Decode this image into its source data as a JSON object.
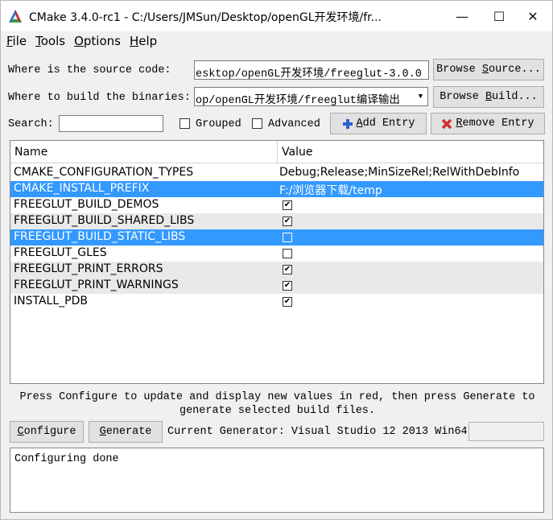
{
  "window": {
    "title": "CMake 3.4.0-rc1 - C:/Users/JMSun/Desktop/openGL开发环境/fr...",
    "minimize": "—",
    "maximize": "☐",
    "close": "✕"
  },
  "menu": {
    "file": {
      "accel": "F",
      "rest": "ile"
    },
    "tools": {
      "accel": "T",
      "rest": "ools"
    },
    "options": {
      "accel": "O",
      "rest": "ptions"
    },
    "help": {
      "accel": "H",
      "rest": "elp"
    }
  },
  "source": {
    "label": "Where is the source code:",
    "value": "esktop/openGL开发环境/freeglut-3.0.0",
    "button_pre": "Browse ",
    "button_accel": "S",
    "button_post": "ource..."
  },
  "build": {
    "label": "Where to build the binaries:",
    "value": "op/openGL开发环境/freeglut编译输出",
    "button_pre": "Browse ",
    "button_accel": "B",
    "button_post": "uild..."
  },
  "search": {
    "label": "Search:",
    "value": ""
  },
  "grouped": {
    "label": "Grouped",
    "checked": false
  },
  "advanced": {
    "label": "Advanced",
    "checked": false
  },
  "add_entry": {
    "accel": "A",
    "rest": "dd Entry"
  },
  "remove_entry": {
    "accel": "R",
    "rest": "emove Entry"
  },
  "table": {
    "headers": {
      "name": "Name",
      "value": "Value"
    },
    "rows": [
      {
        "name": "CMAKE_CONFIGURATION_TYPES",
        "value": "Debug;Release;MinSizeRel;RelWithDebInfo"
      },
      {
        "name": "CMAKE_INSTALL_PREFIX",
        "value": "F:/浏览器下载/temp"
      },
      {
        "name": "FREEGLUT_BUILD_DEMOS",
        "checked": true
      },
      {
        "name": "FREEGLUT_BUILD_SHARED_LIBS",
        "checked": true
      },
      {
        "name": "FREEGLUT_BUILD_STATIC_LIBS",
        "checked": false
      },
      {
        "name": "FREEGLUT_GLES",
        "checked": false
      },
      {
        "name": "FREEGLUT_PRINT_ERRORS",
        "checked": true
      },
      {
        "name": "FREEGLUT_PRINT_WARNINGS",
        "checked": true
      },
      {
        "name": "INSTALL_PDB",
        "checked": true
      }
    ]
  },
  "hint": {
    "line1": "Press Configure to update and display new values in red, then press Generate to",
    "line2": "generate selected build files."
  },
  "configure": {
    "accel": "C",
    "rest": "onfigure"
  },
  "generate": {
    "accel": "G",
    "rest": "enerate"
  },
  "generator_label": "Current Generator: Visual Studio 12 2013 Win64",
  "output": "Configuring done",
  "colors": {
    "selection": "#3399ff",
    "alt_row": "#e9e9e9"
  },
  "icons": {
    "app": "cmake-logo-icon",
    "add": "plus-icon",
    "remove": "red-x-icon"
  }
}
